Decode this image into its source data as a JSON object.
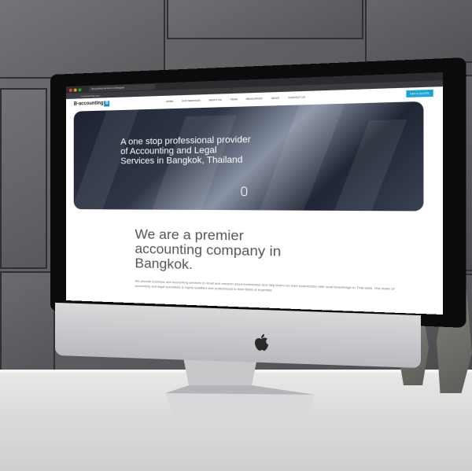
{
  "browser": {
    "tab_title": "accounting services in Bangkok",
    "url": "b-accounting.com",
    "window_controls": [
      "#e0443e",
      "#dea123",
      "#1aab29"
    ]
  },
  "site": {
    "logo_text": "B-accounting",
    "logo_badge": "B",
    "brand_color": "#1ba5d6",
    "menu": [
      "HOME",
      "OUR SERVICES",
      "ABOUT US",
      "TEAM",
      "RESOURCES",
      "NEWS",
      "CONTACT US"
    ],
    "cta": "GET A QUOTE"
  },
  "hero": {
    "headline": "A one stop professional provider of Accounting and Legal Services in Bangkok, Thailand"
  },
  "intro": {
    "heading": "We are a premier accounting company in Bangkok.",
    "body": "We provide business and accounting services to small and medium sized businesses and help them run their businesses with local knowledge in Thai laws. Our team of accounting and legal specialists is highly qualified and professional in their fields of expertise."
  },
  "device": {
    "logo_icon": "apple-icon"
  }
}
